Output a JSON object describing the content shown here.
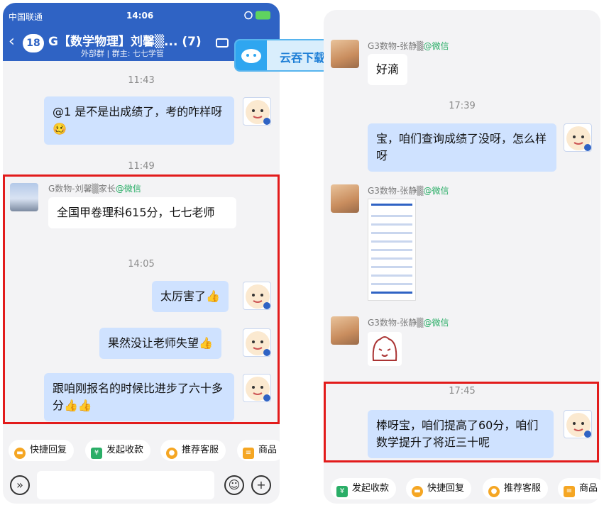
{
  "left": {
    "status": {
      "carrier": "中国联通",
      "time": "14:06"
    },
    "header": {
      "back_count": "18",
      "title": "G【数学物理】刘馨▒... (7)",
      "subtitle": "外部群 | 群主: 七七学管"
    },
    "messages": [
      {
        "time": "11:43"
      },
      {
        "text": "@1 是不是出成绩了，考的咋样呀🥴"
      },
      {
        "time": "11:49"
      },
      {
        "sender": "G数物-刘馨▒家长",
        "sender_tag": "@微信",
        "text": "全国甲卷理科615分，七七老师"
      },
      {
        "time": "14:05"
      },
      {
        "text": "太厉害了👍"
      },
      {
        "text": "果然没让老师失望👍"
      },
      {
        "text": "跟咱刚报名的时候比进步了六十多分👍👍"
      }
    ],
    "quick_actions": [
      "快捷回复",
      "发起收款",
      "推荐客服",
      "商品"
    ],
    "colors": {
      "header": "#2f63c4",
      "my_bubble": "#cfe2ff",
      "highlight": "#e21b1b"
    }
  },
  "download_tag": {
    "label": "云吞下载"
  },
  "right": {
    "messages": [
      {
        "sender": "G3数物-张静▒",
        "sender_tag": "@微信",
        "text": "好滴"
      },
      {
        "time": "17:39"
      },
      {
        "text": "宝，咱们查询成绩了没呀，怎么样呀"
      },
      {
        "sender": "G3数物-张静▒",
        "sender_tag": "@微信",
        "image": "成绩截图"
      },
      {
        "sender": "G3数物-张静▒",
        "sender_tag": "@微信",
        "image": "表情"
      },
      {
        "time": "17:45"
      },
      {
        "text": "棒呀宝，咱们提高了60分，咱们数学提升了将近三十呢"
      }
    ],
    "quick_actions": [
      "发起收款",
      "快捷回复",
      "推荐客服",
      "商品"
    ]
  }
}
